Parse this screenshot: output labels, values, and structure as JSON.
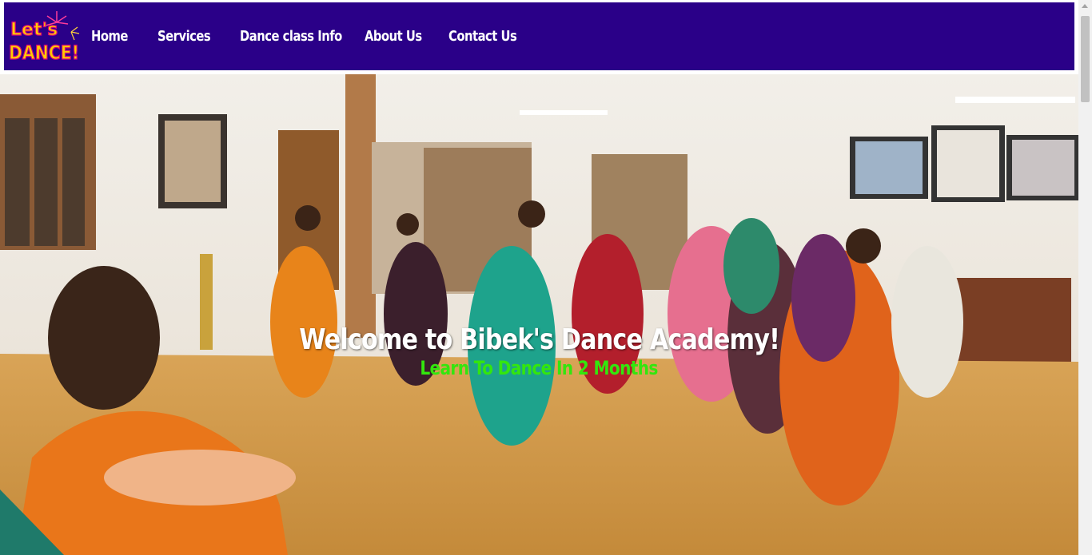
{
  "logo": {
    "text_line1": "Let's",
    "text_line2": "DANCE!"
  },
  "nav": {
    "items": [
      {
        "label": "Home"
      },
      {
        "label": "Services"
      },
      {
        "label": "Dance class Info"
      },
      {
        "label": "About Us"
      },
      {
        "label": "Contact Us"
      }
    ]
  },
  "hero": {
    "title": "Welcome to Bibek's Dance Academy!",
    "subtitle": "Learn To Dance In 2 Months"
  },
  "colors": {
    "nav_bg": "#2a0088",
    "subtitle": "#33e60e",
    "title": "#ffffff"
  }
}
